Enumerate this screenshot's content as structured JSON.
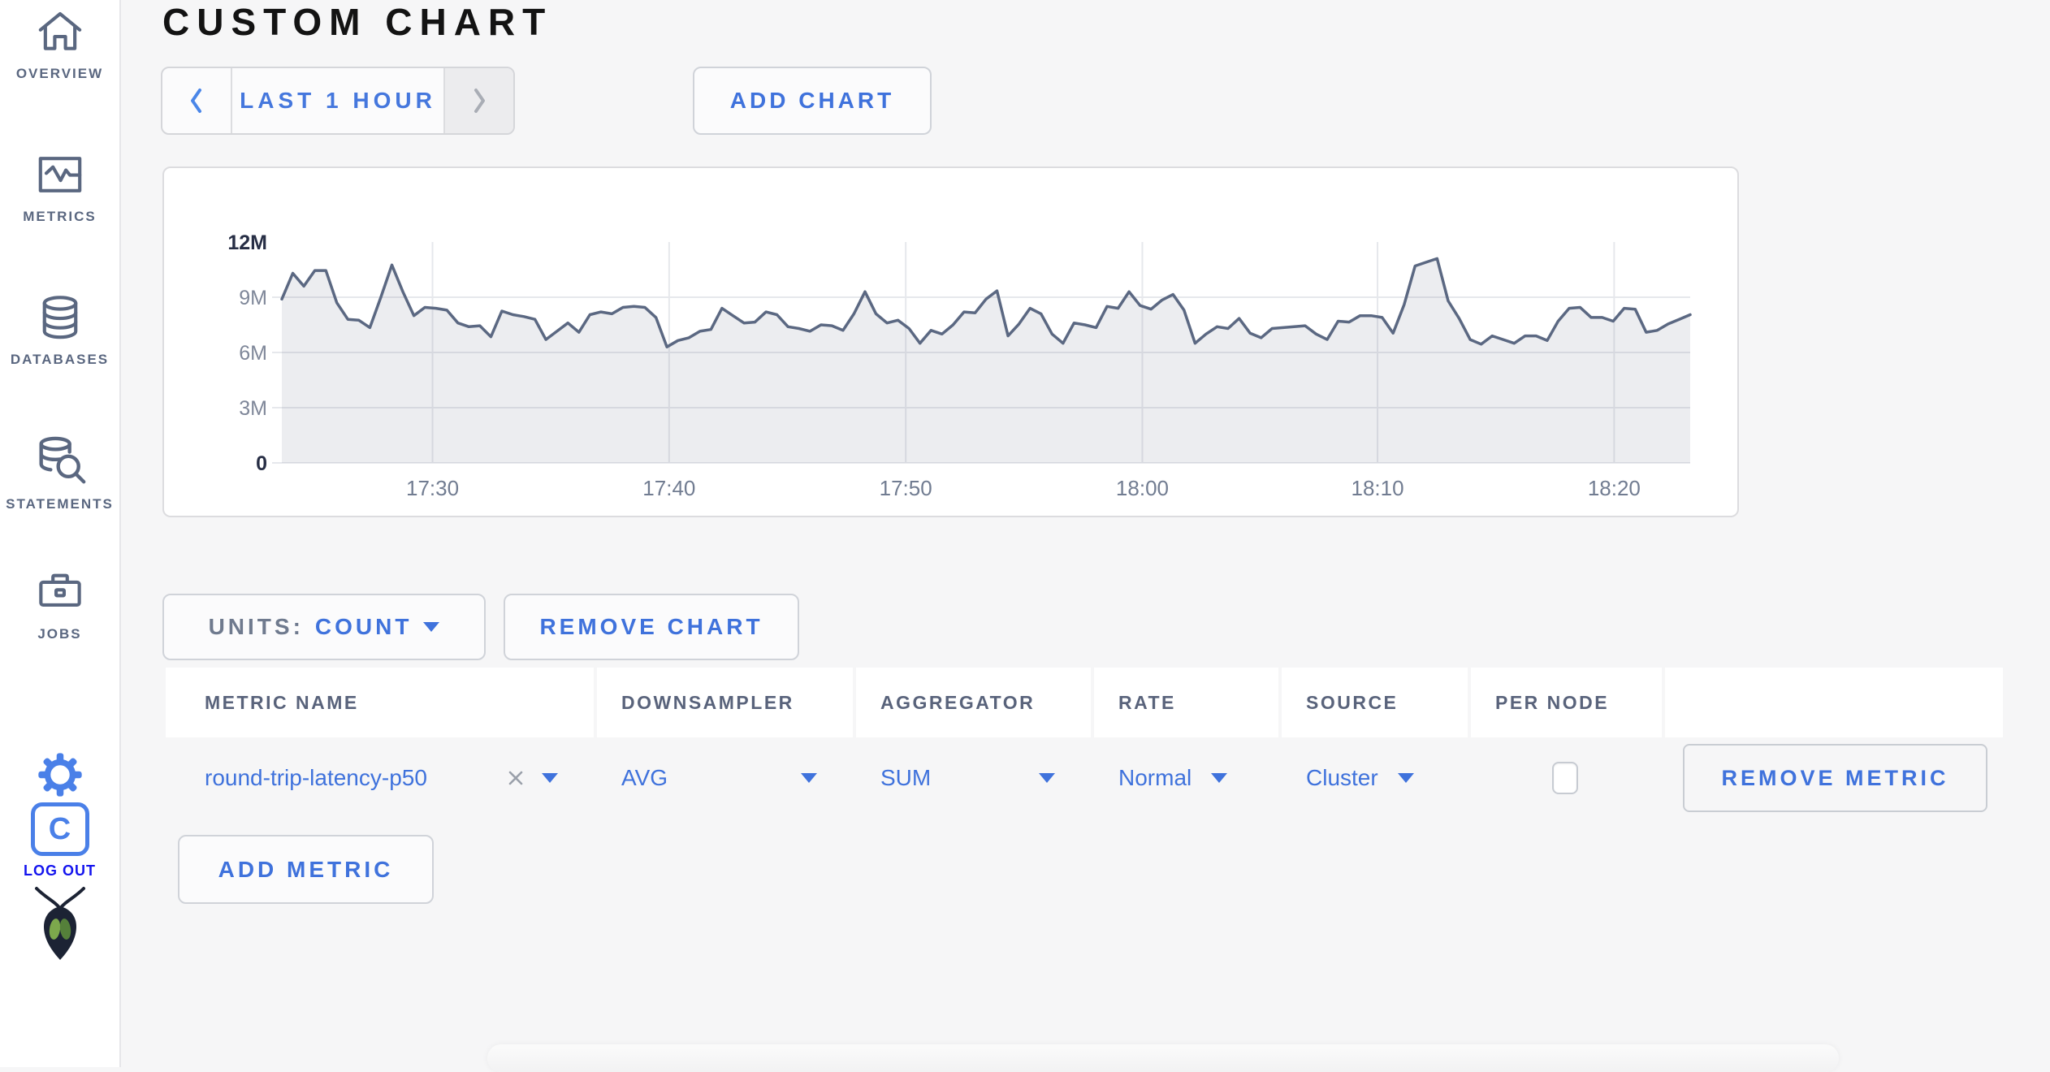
{
  "page_title": "CUSTOM CHART",
  "sidebar": {
    "items": [
      {
        "label": "OVERVIEW",
        "icon": "home-icon"
      },
      {
        "label": "METRICS",
        "icon": "metrics-icon"
      },
      {
        "label": "DATABASES",
        "icon": "database-icon"
      },
      {
        "label": "STATEMENTS",
        "icon": "statements-icon"
      },
      {
        "label": "JOBS",
        "icon": "jobs-icon"
      }
    ],
    "logout": {
      "label": "LOG OUT",
      "badge_letter": "C"
    }
  },
  "toolbar": {
    "time_range_label": "LAST 1 HOUR",
    "add_chart_label": "ADD CHART"
  },
  "chart_controls": {
    "units_label": "UNITS:",
    "units_value": "COUNT",
    "remove_chart_label": "REMOVE CHART",
    "add_metric_label": "ADD METRIC"
  },
  "table": {
    "headers": [
      "METRIC NAME",
      "DOWNSAMPLER",
      "AGGREGATOR",
      "RATE",
      "SOURCE",
      "PER NODE"
    ],
    "rows": [
      {
        "metric_name": "round-trip-latency-p50",
        "downsampler": "AVG",
        "aggregator": "SUM",
        "rate": "Normal",
        "source": "Cluster",
        "per_node_checked": false,
        "remove_label": "REMOVE METRIC"
      }
    ]
  },
  "colors": {
    "accent_blue": "#3f72dc",
    "sidebar_gray_blue": "#5a6780",
    "line": "#5b6882",
    "area_fill": "rgba(95,108,135,0.12)",
    "grid": "#e6e8ec",
    "axis_dark": "#272e45",
    "axis_gray": "#7f8799",
    "tick_gray": "#717c91"
  },
  "chart_data": {
    "type": "area",
    "title": "",
    "xlabel": "",
    "ylabel": "",
    "unit": "count",
    "ylim": [
      0,
      12000000
    ],
    "grid": true,
    "legend": "none",
    "y_tick_values_millions": [
      0,
      3,
      6,
      9,
      12
    ],
    "y_tick_labels": [
      "0",
      "3M",
      "6M",
      "9M",
      "12M"
    ],
    "x_tick_labels": [
      "17:30",
      "17:40",
      "17:50",
      "18:00",
      "18:10",
      "18:20"
    ],
    "x_tick_fractions": [
      0.107,
      0.275,
      0.443,
      0.611,
      0.778,
      0.946
    ],
    "series": [
      {
        "name": "round-trip-latency-p50",
        "value_unit": "millions",
        "values": [
          8.9,
          10.3,
          9.6,
          10.45,
          10.45,
          8.7,
          7.8,
          7.75,
          7.35,
          9.0,
          10.75,
          9.3,
          8.0,
          8.45,
          8.4,
          8.3,
          7.6,
          7.4,
          7.45,
          6.85,
          8.25,
          8.05,
          7.95,
          7.8,
          6.7,
          7.15,
          7.6,
          7.1,
          8.05,
          8.2,
          8.1,
          8.45,
          8.5,
          8.45,
          7.9,
          6.3,
          6.65,
          6.8,
          7.15,
          7.25,
          8.4,
          8.0,
          7.6,
          7.65,
          8.2,
          8.05,
          7.4,
          7.3,
          7.15,
          7.5,
          7.45,
          7.2,
          8.1,
          9.3,
          8.1,
          7.6,
          7.75,
          7.3,
          6.5,
          7.2,
          7.0,
          7.5,
          8.2,
          8.15,
          8.9,
          9.35,
          6.9,
          7.55,
          8.4,
          8.1,
          7.0,
          6.5,
          7.6,
          7.5,
          7.35,
          8.5,
          8.4,
          9.3,
          8.55,
          8.35,
          8.85,
          9.15,
          8.3,
          6.5,
          7.0,
          7.4,
          7.3,
          7.85,
          7.05,
          6.8,
          7.3,
          7.35,
          7.4,
          7.45,
          7.0,
          6.7,
          7.7,
          7.65,
          8.0,
          8.0,
          7.9,
          7.05,
          8.6,
          10.7,
          10.9,
          11.1,
          8.8,
          7.85,
          6.7,
          6.45,
          6.9,
          6.7,
          6.5,
          6.9,
          6.9,
          6.65,
          7.7,
          8.4,
          8.45,
          7.9,
          7.9,
          7.7,
          8.4,
          8.35,
          7.1,
          7.2,
          7.55,
          7.8,
          8.05
        ]
      }
    ]
  }
}
